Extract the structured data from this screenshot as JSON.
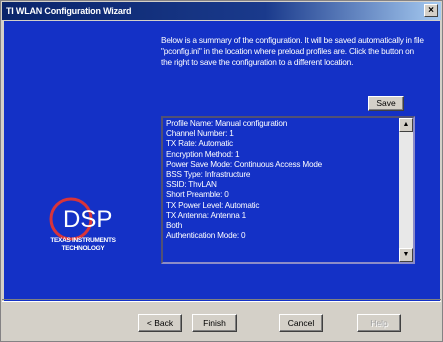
{
  "window": {
    "title": "TI WLAN Configuration Wizard",
    "close_label": "×"
  },
  "summary": {
    "text": "Below is a summary of the configuration. It will be saved automatically in file \"pconfig.ini\" in the location where preload profiles are. Click the button on the right to save the configuration to a different location.",
    "save_label": "Save"
  },
  "config_list": {
    "lines": [
      "Profile Name: Manual configuration",
      "Channel Number: 1",
      "TX Rate: Automatic",
      "Encryption Method: 1",
      "Power Save Mode: Continuous Access Mode",
      "BSS Type: Infrastructure",
      "SSID: ThvLAN",
      "Short Preamble: 0",
      "TX Power Level: Automatic",
      "TX Antenna: Antenna 1",
      "Both",
      "Authentication Mode: 0"
    ]
  },
  "logo": {
    "brand": "DSP",
    "company_line1": "TEXAS INSTRUMENTS",
    "company_line2": "TECHNOLOGY"
  },
  "buttons": {
    "back": "< Back",
    "finish": "Finish",
    "cancel": "Cancel",
    "help": "Help"
  },
  "colors": {
    "panel_blue": "#1431c6",
    "logo_red": "#d8343a"
  }
}
